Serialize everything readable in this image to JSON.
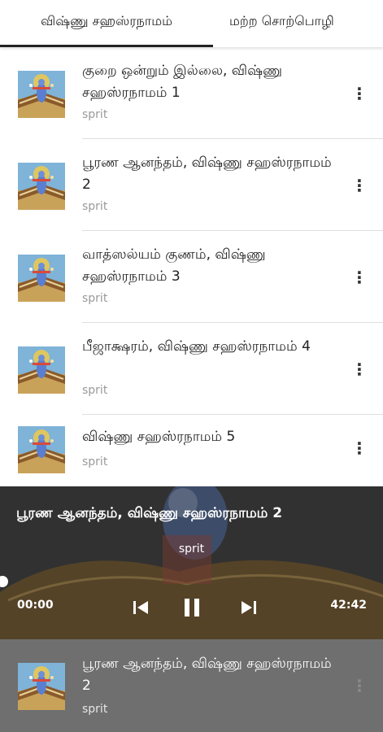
{
  "tabs": [
    {
      "label": "விஷ்ணு சஹஸ்ரநாமம்",
      "active": true
    },
    {
      "label": "மற்ற சொற்பொழி"
    }
  ],
  "items": [
    {
      "title": "குறை ஒன்றும் இல்லை, விஷ்ணு சஹஸ்ரநாமம் 1",
      "author": "sprit",
      "menu": "⋮"
    },
    {
      "title": "பூரண ஆனந்தம், விஷ்ணு சஹஸ்ரநாமம் 2",
      "author": "sprit",
      "menu": "⋮"
    },
    {
      "title": "வாத்ஸல்யம் குணம், விஷ்ணு சஹஸ்ரநாமம் 3",
      "author": "sprit",
      "menu": "⋮"
    },
    {
      "title": "பீஜாக்ஷரம், விஷ்ணு சஹஸ்ரநாமம் 4",
      "author": "sprit",
      "menu": "⋮"
    },
    {
      "title": "விஷ்ணு சஹஸ்ரநாமம் 5",
      "author": "sprit",
      "menu": "⋮"
    }
  ],
  "player": {
    "title": "பூரண ஆனந்தம், விஷ்ணு சஹஸ்ரநாமம் 2",
    "author": "sprit",
    "current_time": "00:00",
    "total_time": "42:42",
    "progress": 0
  },
  "mini_player": {
    "title": "பூரண ஆனந்தம், விஷ்ணு சஹஸ்ரநாமம் 2",
    "author": "sprit",
    "menu": "⋮"
  },
  "colors": {
    "divider": "#dedede",
    "player_overlay": "#3a3a3a",
    "mini_bg": "#6f6f6f"
  }
}
